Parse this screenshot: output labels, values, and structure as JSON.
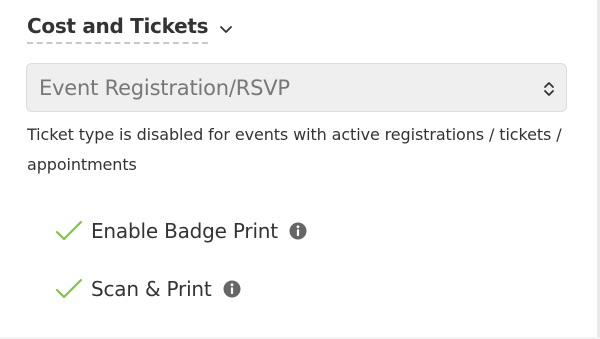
{
  "section": {
    "title": "Cost and Tickets",
    "toggle_icon": "chevron-down-icon"
  },
  "ticket_type_select": {
    "value": "Event Registration/RSVP",
    "icon": "updown-arrows-icon",
    "disabled": true
  },
  "help_text": "Ticket type is disabled for events with active registrations / tickets / appointments",
  "options": [
    {
      "label": "Enable Badge Print",
      "checked": true,
      "check_icon": "checkmark-icon",
      "info_icon": "info-circle-icon"
    },
    {
      "label": "Scan & Print",
      "checked": true,
      "check_icon": "checkmark-icon",
      "info_icon": "info-circle-icon"
    }
  ],
  "colors": {
    "check_green": "#7bc142",
    "select_background": "#efefef",
    "info_icon": "#666666"
  }
}
